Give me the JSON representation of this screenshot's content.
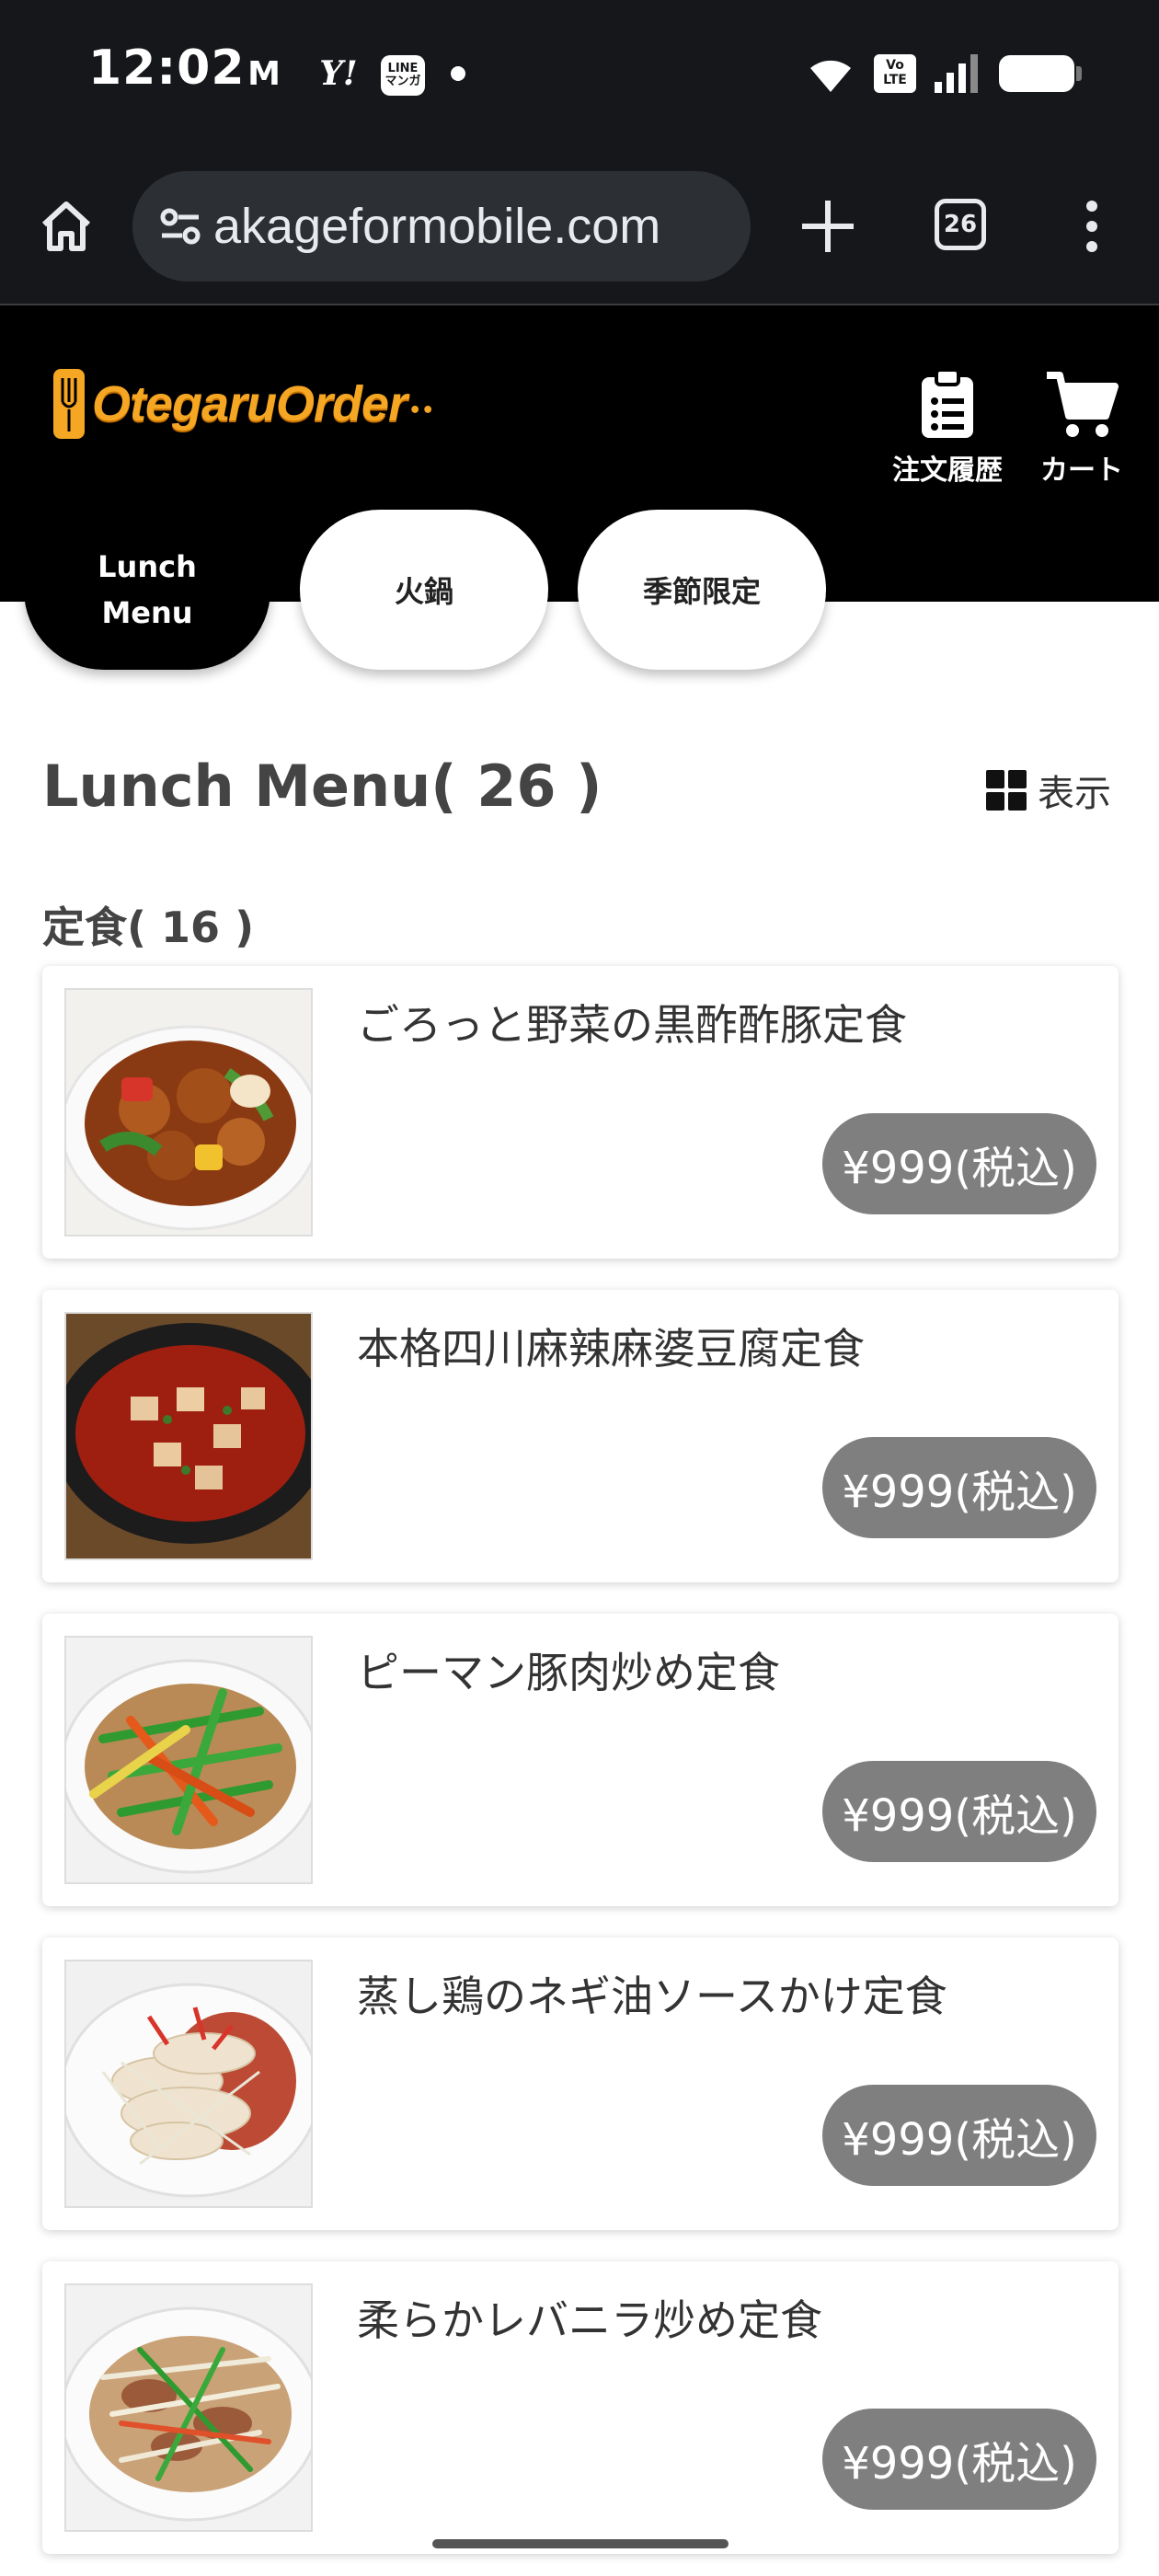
{
  "status_bar": {
    "time": "12:02",
    "notif_gmail": "M",
    "notif_yahoo": "Y!",
    "notif_line": "LINE\nマンガ",
    "volte": "Vo\nLTE"
  },
  "browser": {
    "url": "akageformobile.com",
    "tab_count": "26"
  },
  "header": {
    "logo_text": "OtegaruOrder",
    "logo_dots": "••",
    "order_history_label": "注文履歴",
    "cart_label": "カート"
  },
  "categories": [
    {
      "label": "Lunch\nMenu",
      "active": true
    },
    {
      "label": "火鍋",
      "active": false
    },
    {
      "label": "季節限定",
      "active": false
    }
  ],
  "menu": {
    "title": "Lunch Menu( 26 )",
    "view_label": "表示",
    "section_title": "定食( 16 )",
    "items": [
      {
        "name": "ごろっと野菜の黒酢酢豚定食",
        "price": "¥999(税込)"
      },
      {
        "name": "本格四川麻辣麻婆豆腐定食",
        "price": "¥999(税込)"
      },
      {
        "name": "ピーマン豚肉炒め定食",
        "price": "¥999(税込)"
      },
      {
        "name": "蒸し鶏のネギ油ソースかけ定食",
        "price": "¥999(税込)"
      },
      {
        "name": "柔らかレバニラ炒め定食",
        "price": "¥999(税込)"
      }
    ]
  },
  "colors": {
    "accent": "#f5a623",
    "header_bg": "#000000",
    "price_pill": "#7f7f7f"
  }
}
